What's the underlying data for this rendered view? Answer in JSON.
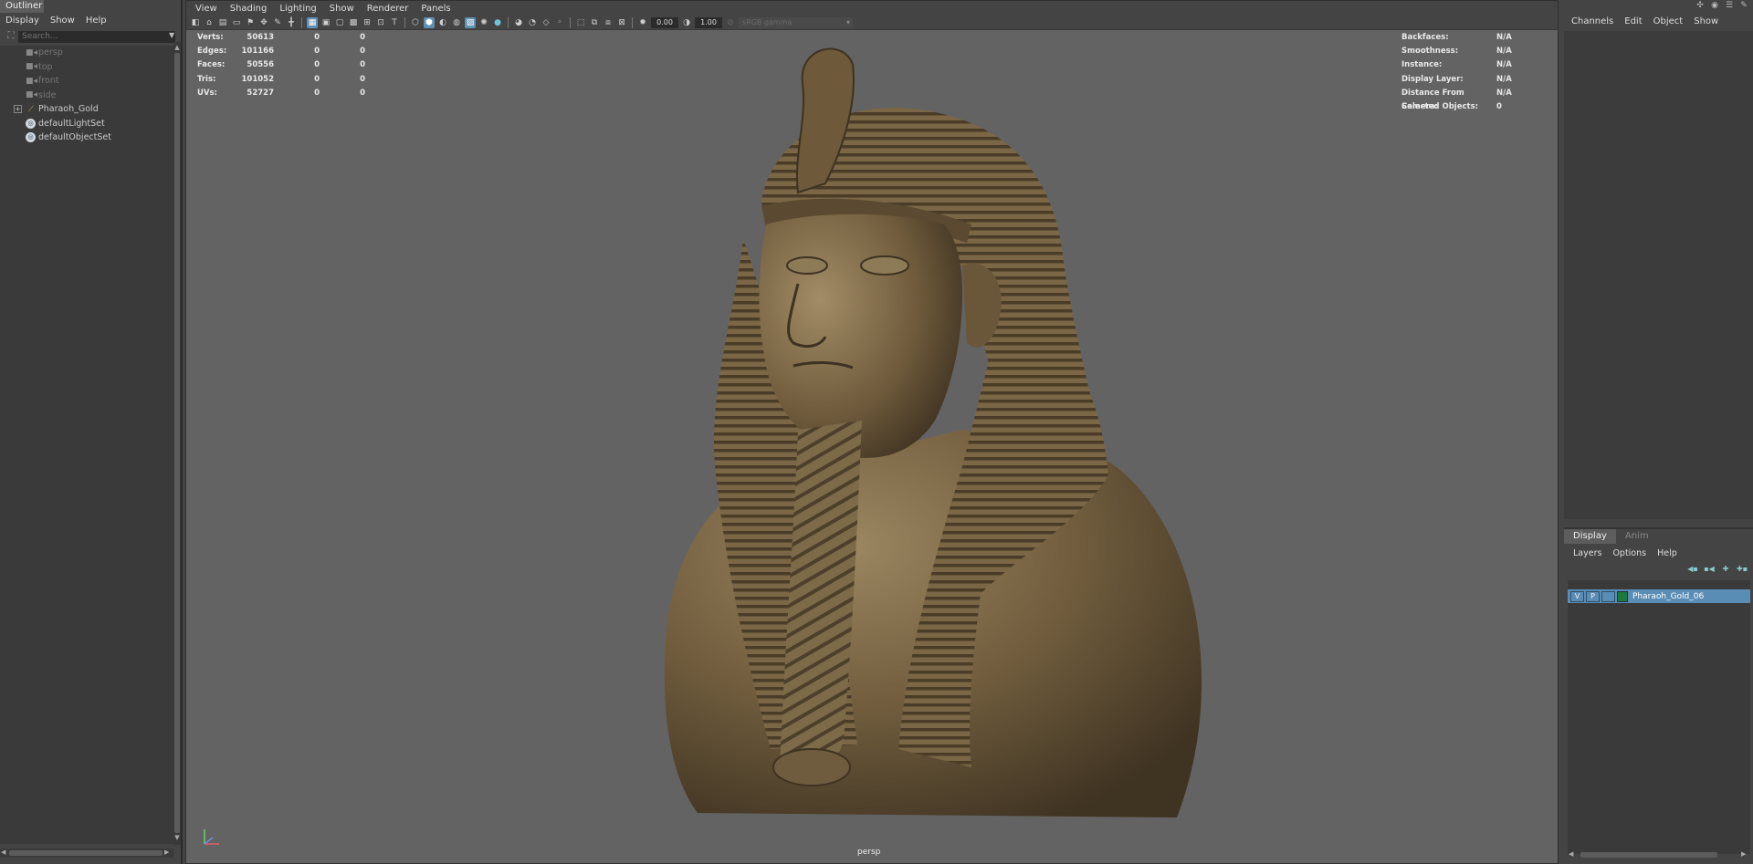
{
  "outliner": {
    "title": "Outliner",
    "menu": [
      "Display",
      "Show",
      "Help"
    ],
    "search_placeholder": "Search...",
    "items": [
      {
        "label": "persp",
        "type": "camera"
      },
      {
        "label": "top",
        "type": "camera"
      },
      {
        "label": "front",
        "type": "camera"
      },
      {
        "label": "side",
        "type": "camera"
      },
      {
        "label": "Pharaoh_Gold",
        "type": "group"
      },
      {
        "label": "defaultLightSet",
        "type": "set"
      },
      {
        "label": "defaultObjectSet",
        "type": "set"
      }
    ]
  },
  "viewport": {
    "menu": [
      "View",
      "Shading",
      "Lighting",
      "Show",
      "Renderer",
      "Panels"
    ],
    "exposure": "0.00",
    "gamma": "1.00",
    "colorspace": "sRGB gamma",
    "camera_label": "persp",
    "hud_left": [
      {
        "label": "Verts:",
        "v1": "50613",
        "v2": "0",
        "v3": "0"
      },
      {
        "label": "Edges:",
        "v1": "101166",
        "v2": "0",
        "v3": "0"
      },
      {
        "label": "Faces:",
        "v1": "50556",
        "v2": "0",
        "v3": "0"
      },
      {
        "label": "Tris:",
        "v1": "101052",
        "v2": "0",
        "v3": "0"
      },
      {
        "label": "UVs:",
        "v1": "52727",
        "v2": "0",
        "v3": "0"
      }
    ],
    "hud_right": [
      {
        "label": "Backfaces:",
        "value": "N/A"
      },
      {
        "label": "Smoothness:",
        "value": "N/A"
      },
      {
        "label": "Instance:",
        "value": "N/A"
      },
      {
        "label": "Display Layer:",
        "value": "N/A"
      },
      {
        "label": "Distance From Camera:",
        "value": "N/A"
      },
      {
        "label": "Selected Objects:",
        "value": "0"
      }
    ]
  },
  "channels": {
    "menu": [
      "Channels",
      "Edit",
      "Object",
      "Show"
    ]
  },
  "layers": {
    "tabs": [
      "Display",
      "Anim"
    ],
    "menu": [
      "Layers",
      "Options",
      "Help"
    ],
    "rows": [
      {
        "v": "V",
        "p": "P",
        "name": "Pharaoh_Gold_06",
        "color": "#1c7a3c"
      }
    ]
  },
  "colors": {
    "viewport_bg": "#636363",
    "panel_bg": "#444444",
    "selection": "#5a8db5",
    "statue": "#7a6644"
  }
}
